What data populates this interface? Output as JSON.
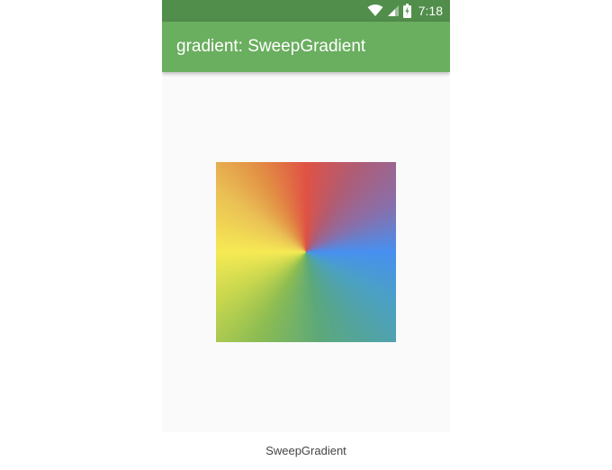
{
  "status_bar": {
    "time": "7:18",
    "icons": [
      "wifi-icon",
      "signal-icon",
      "battery-icon"
    ],
    "background_color": "#518d4b"
  },
  "app_bar": {
    "title": "gradient: SweepGradient",
    "background_color": "#6aae5f"
  },
  "gradient": {
    "type": "SweepGradient",
    "colors": [
      "#4790f0",
      "#5ca87a",
      "#f6ea54",
      "#e05244",
      "#8a6ea8"
    ]
  },
  "caption": "SweepGradient"
}
